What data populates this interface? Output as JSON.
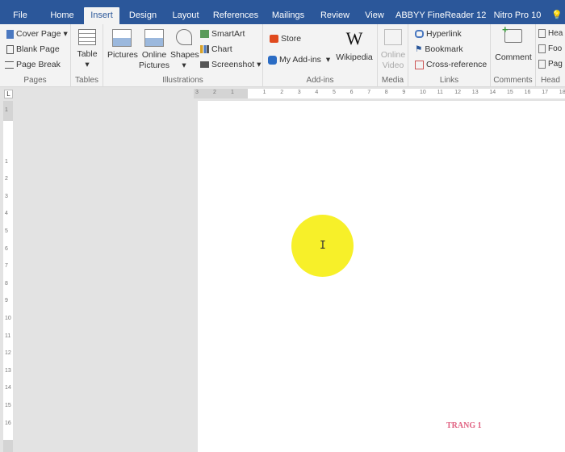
{
  "tabs": [
    "File",
    "Home",
    "Insert",
    "Design",
    "Layout",
    "References",
    "Mailings",
    "Review",
    "View",
    "ABBYY FineReader 12",
    "Nitro Pro 10"
  ],
  "active_tab": "Insert",
  "ribbon": {
    "pages": {
      "label": "Pages",
      "cover": "Cover Page",
      "blank": "Blank Page",
      "break": "Page Break"
    },
    "tables": {
      "label": "Tables",
      "table": "Table"
    },
    "illustrations": {
      "label": "Illustrations",
      "pictures": "Pictures",
      "online1": "Online",
      "online2": "Pictures",
      "shapes": "Shapes",
      "smartart": "SmartArt",
      "chart": "Chart",
      "screenshot": "Screenshot"
    },
    "addins": {
      "label": "Add-ins",
      "store": "Store",
      "myaddins": "My Add-ins",
      "wikipedia": "Wikipedia"
    },
    "media": {
      "label": "Media",
      "v1": "Online",
      "v2": "Video"
    },
    "links": {
      "label": "Links",
      "hyperlink": "Hyperlink",
      "bookmark": "Bookmark",
      "cross": "Cross-reference"
    },
    "comments": {
      "label": "Comments",
      "comment": "Comment"
    },
    "header": {
      "label": "Head",
      "h1": "Hea",
      "h2": "Foo",
      "h3": "Pag"
    }
  },
  "ruler_h": [
    "3",
    "2",
    "1",
    "1",
    "2",
    "3",
    "4",
    "5",
    "6",
    "7",
    "8",
    "9",
    "10",
    "11",
    "12",
    "13",
    "14",
    "15",
    "16",
    "17",
    "18"
  ],
  "ruler_v": [
    "1",
    "1",
    "2",
    "3",
    "4",
    "5",
    "6",
    "7",
    "8",
    "9",
    "10",
    "11",
    "12",
    "13",
    "14",
    "15",
    "16"
  ],
  "document": {
    "footer_text": "TRANG 1"
  },
  "colors": {
    "accent": "#2b579a",
    "highlight": "#f7ef1e",
    "footer": "#e06080"
  }
}
